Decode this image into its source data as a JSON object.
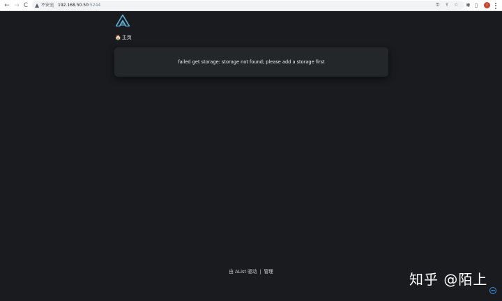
{
  "browser": {
    "back_icon": "←",
    "forward_icon": "→",
    "reload_icon": "C",
    "warning_icon": "▲",
    "security_label": "不安全",
    "url_host": "192.168.50.50",
    "url_port": ":5244",
    "key_icon": "⚿",
    "share_icon": "⇪",
    "star_icon": "☆",
    "extensions_icon": "✱",
    "sidepanel_icon": "▯",
    "profile_initial": "J"
  },
  "page": {
    "home_icon": "🏠",
    "breadcrumb_home": "主页",
    "error_message": "failed get storage: storage not found; please add a storage first"
  },
  "footer": {
    "powered_by": "由 AList 驱动",
    "separator": "|",
    "manage": "管理"
  },
  "watermark": {
    "text": "知乎 @陌上"
  },
  "colors": {
    "page_background": "#1a1b1e",
    "card_background": "#24272a",
    "logo_accent": "#5fb1d8",
    "home_icon": "#e5b76a",
    "chat_accent": "#3d8fe0"
  }
}
